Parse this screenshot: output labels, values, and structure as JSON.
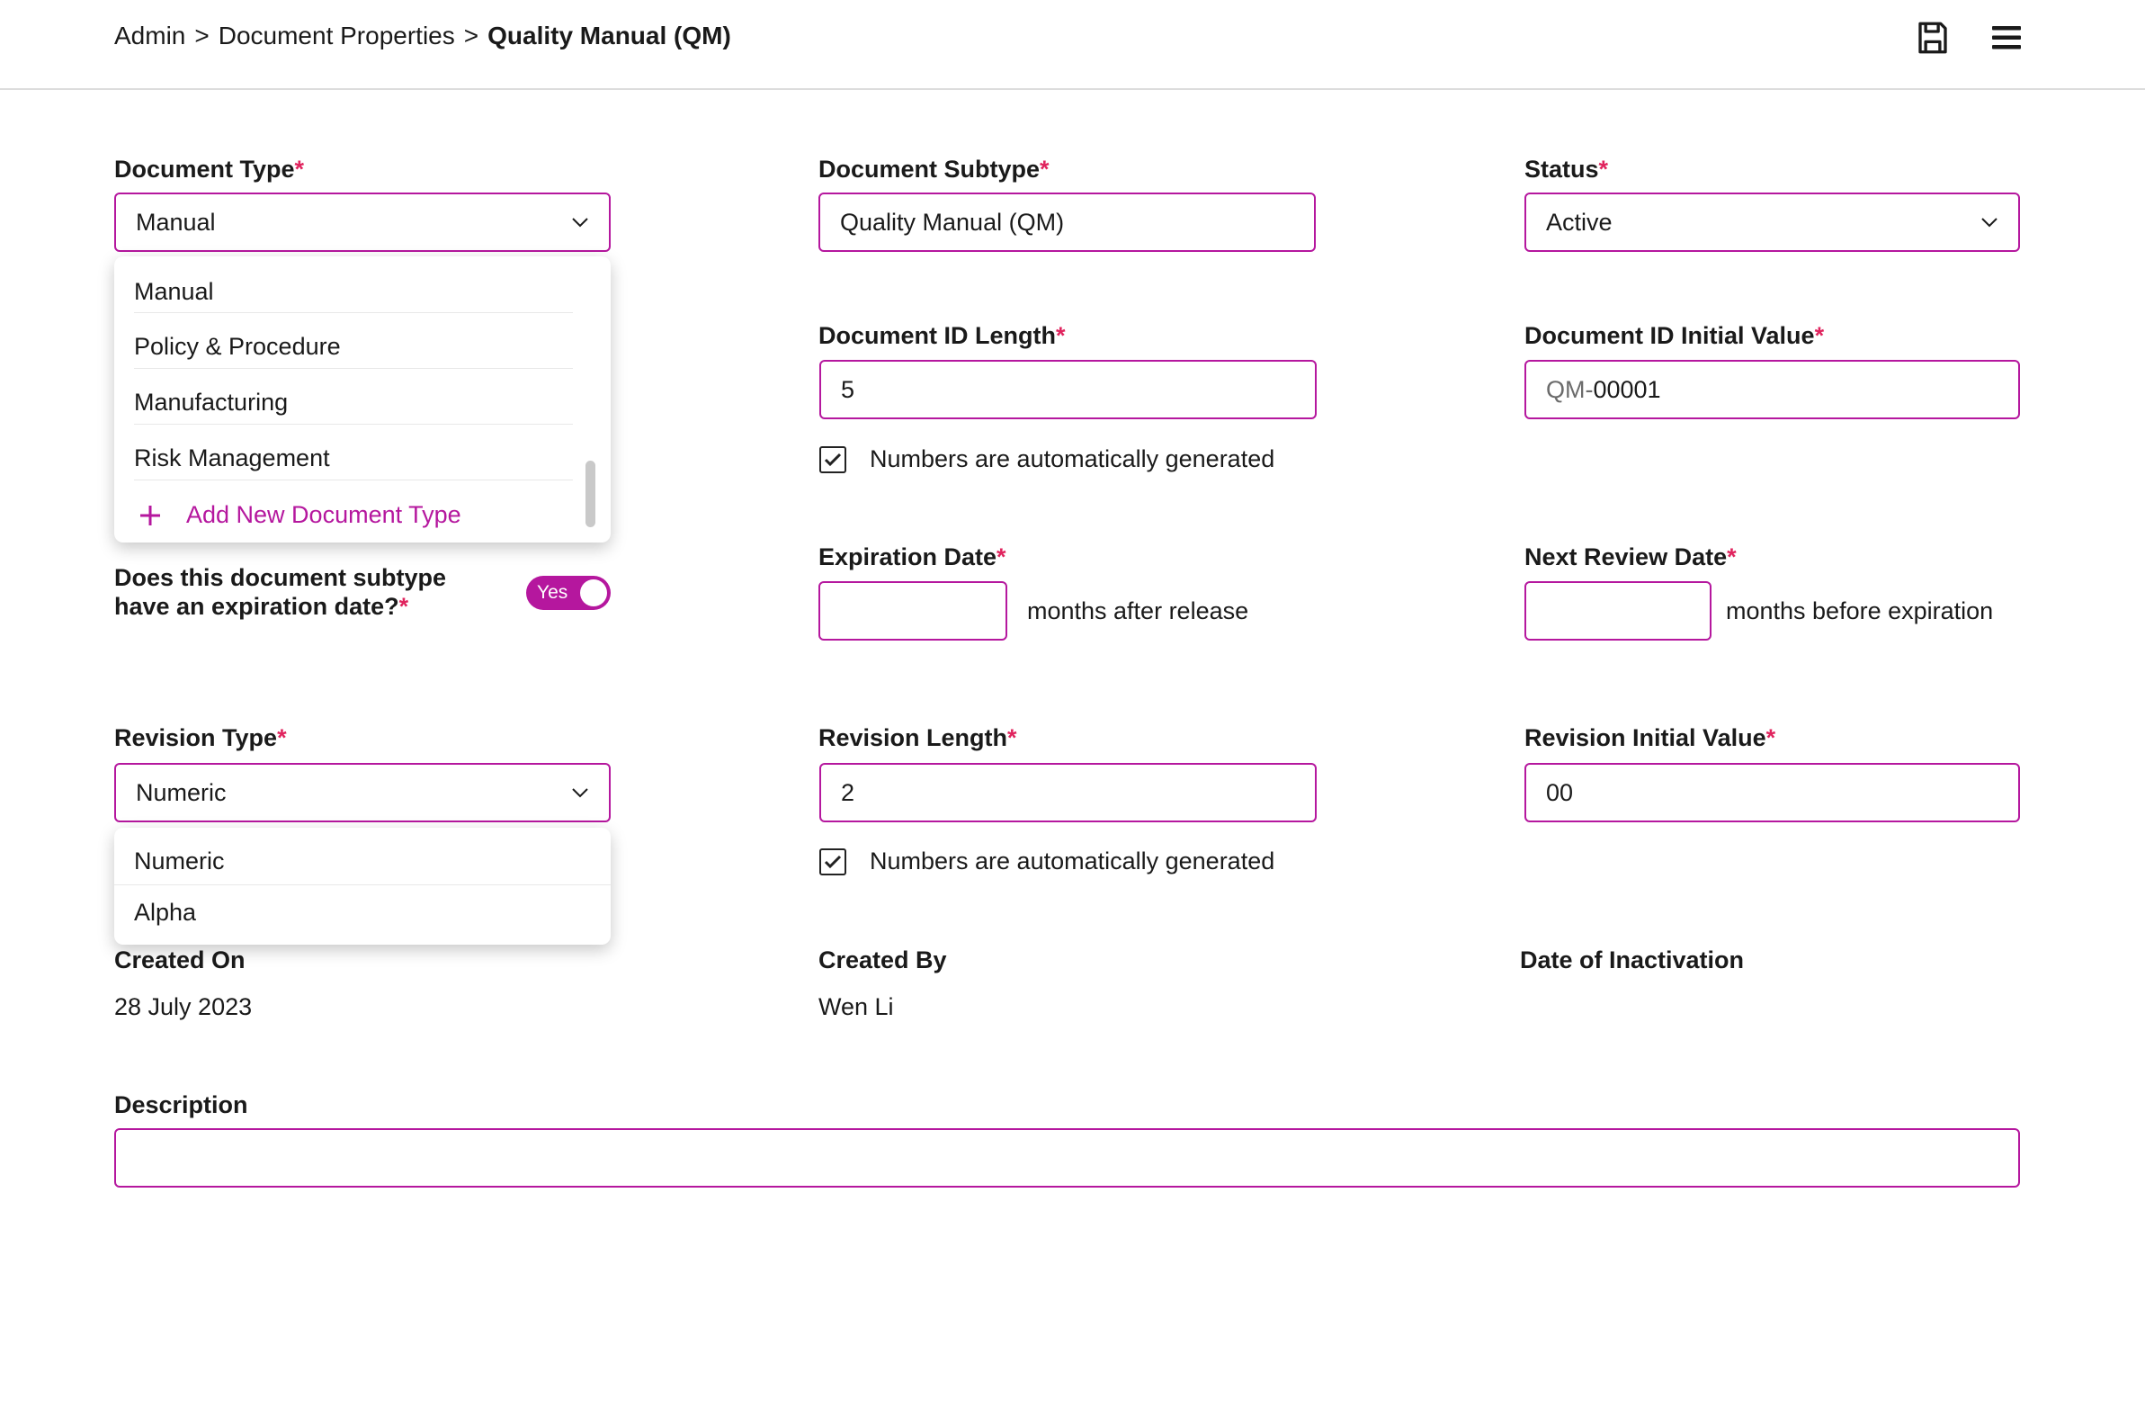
{
  "breadcrumb": {
    "items": [
      "Admin",
      "Document Properties"
    ],
    "separator": ">",
    "current": "Quality Manual (QM)"
  },
  "header_icons": {
    "save": "save-icon",
    "menu": "menu-icon"
  },
  "colors": {
    "accent": "#b5179e",
    "required": "#e0245e",
    "text": "#1a1a1a"
  },
  "required_mark": "*",
  "document_type": {
    "label": "Document Type",
    "value": "Manual",
    "options": [
      "Manual",
      "Policy & Procedure",
      "Manufacturing",
      "Risk Management"
    ],
    "add_new": "Add New Document Type"
  },
  "document_subtype": {
    "label": "Document Subtype",
    "value": "Quality Manual (QM)"
  },
  "status": {
    "label": "Status",
    "value": "Active"
  },
  "document_id_length": {
    "label": "Document ID Length",
    "value": "5",
    "auto_label": "Numbers are automatically generated",
    "auto_checked": true
  },
  "document_id_initial": {
    "label": "Document ID Initial Value",
    "prefix": "QM-",
    "value": "00001"
  },
  "expiration_question": {
    "line1": "Does this document subtype",
    "line2": "have an expiration date?",
    "toggle_label": "Yes",
    "toggle_on": true
  },
  "expiration_date": {
    "label": "Expiration Date",
    "value": "",
    "suffix": "months after release"
  },
  "next_review": {
    "label": "Next Review Date",
    "value": "",
    "suffix": "months before expiration"
  },
  "revision_type": {
    "label": "Revision Type",
    "value": "Numeric",
    "options": [
      "Numeric",
      "Alpha"
    ]
  },
  "revision_length": {
    "label": "Revision Length",
    "value": "2",
    "auto_label": "Numbers are automatically generated",
    "auto_checked": true
  },
  "revision_initial": {
    "label": "Revision Initial Value",
    "value": "00"
  },
  "created_on": {
    "label": "Created On",
    "value": "28 July 2023"
  },
  "created_by": {
    "label": "Created By",
    "value": "Wen Li"
  },
  "inactivation": {
    "label": "Date of Inactivation",
    "value": ""
  },
  "description": {
    "label": "Description",
    "value": ""
  }
}
